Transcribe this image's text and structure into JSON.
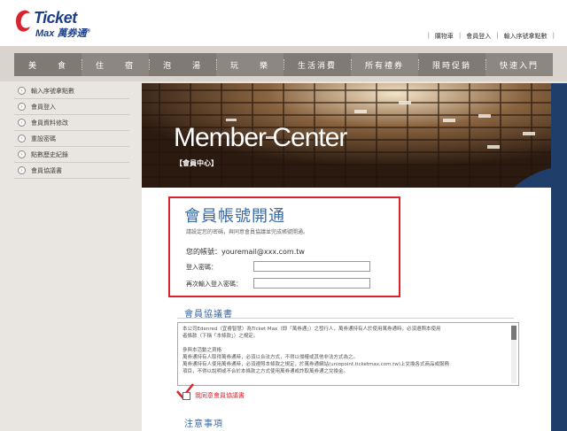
{
  "brand": {
    "name_en": "Ticket",
    "name_sub": "Max",
    "name_zh": "萬券通",
    "mark": "®",
    "accent": "#d9232d",
    "blue": "#1d3f8a"
  },
  "toplinks": [
    "購物車",
    "會員登入",
    "輸入序號拿點數"
  ],
  "nav": [
    "美　　食",
    "住　　宿",
    "泡　　湯",
    "玩　　樂",
    "生活消費",
    "所有禮券",
    "限時促銷",
    "快速入門"
  ],
  "sidebar": [
    "輸入序號拿點數",
    "會員登入",
    "會員資料修改",
    "重設密碼",
    "點數歷史紀錄",
    "會員協議書"
  ],
  "banner": {
    "title": "Member Center",
    "subtitle": "【會員中心】"
  },
  "activation": {
    "heading": "會員帳號開通",
    "hint": "請設定您的密碼，與同意會員協議並完成帳號開通。",
    "account_label": "您的帳號：",
    "account_value": "youremail@xxx.com.tw",
    "password_label": "登入密碼：",
    "password_confirm_label": "再次輸入登入密碼："
  },
  "agreement": {
    "heading": "會員協議書",
    "text": "本公司Edenred（宜睿智慧）為Ticket Max（即「萬券通」）之發行人，萬券通持有人於使用萬券通時，必須遵照本使用\n者條款（下稱「本條款」）之規定。\n\n參與本活動之資格\n萬券通持有人取得萬券通時，必須以合法方式，不得以侵權或其他非法方式為之。\n萬券通持有人使用萬券通時，必須遵照本條款之規定，於萬券通網站(uniopoint.ticketmax.com.tw)上兌換各式商品或服務\n項目，不得以說明或不合於本條款之方式使用萬券通或詐取萬券通之兌換金。",
    "checkbox_label": "我同意會員協議書"
  },
  "notes": {
    "heading": "注意事項"
  }
}
